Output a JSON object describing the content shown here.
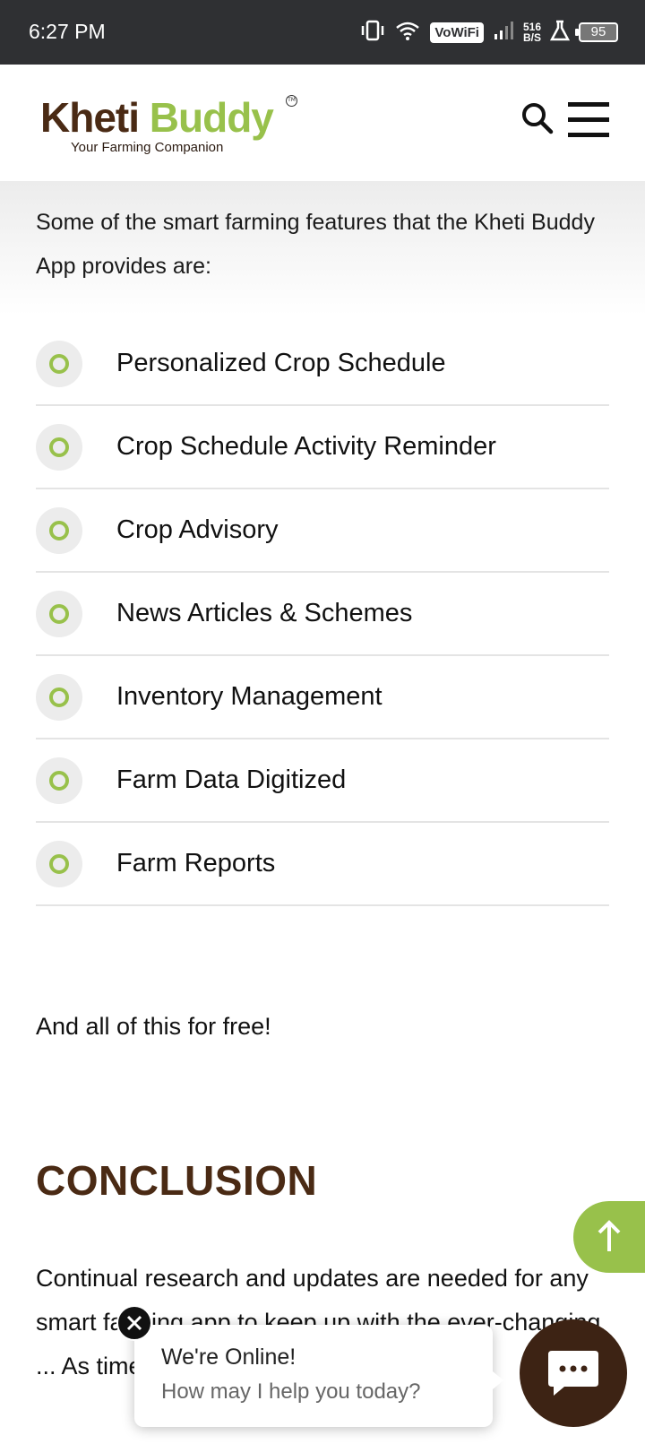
{
  "status_bar": {
    "time": "6:27 PM",
    "vowifi": "VoWiFi",
    "speed_value": "516",
    "speed_unit": "B/S",
    "battery": "95"
  },
  "header": {
    "logo_part1": "Kheti",
    "logo_part2": "Buddy",
    "tagline": "Your Farming Companion",
    "logo_tm": "TM"
  },
  "content": {
    "intro": "Some of the smart farming features that the Kheti Buddy App provides are:",
    "features": [
      "Personalized Crop Schedule",
      "Crop Schedule Activity Reminder",
      "Crop Advisory",
      "News Articles & Schemes",
      "Inventory Management",
      "Farm Data Digitized",
      "Farm Reports"
    ],
    "free_note": "And all of this for free!",
    "conclusion_heading": "CONCLUSION",
    "conclusion_text": "Continual research and updates are needed for any smart farming app to keep up with the ever-changing ... As time goes by, ... their"
  },
  "chat": {
    "title": "We're Online!",
    "subtitle": "How may I help you today?"
  },
  "colors": {
    "brand_brown": "#4a2a14",
    "brand_green": "#98c14b",
    "status_bar": "#2f3033"
  },
  "icons": {
    "search": "search-icon",
    "menu": "hamburger-menu-icon",
    "scroll_top": "arrow-up-icon",
    "chat": "chat-bubble-icon",
    "close": "close-icon"
  }
}
